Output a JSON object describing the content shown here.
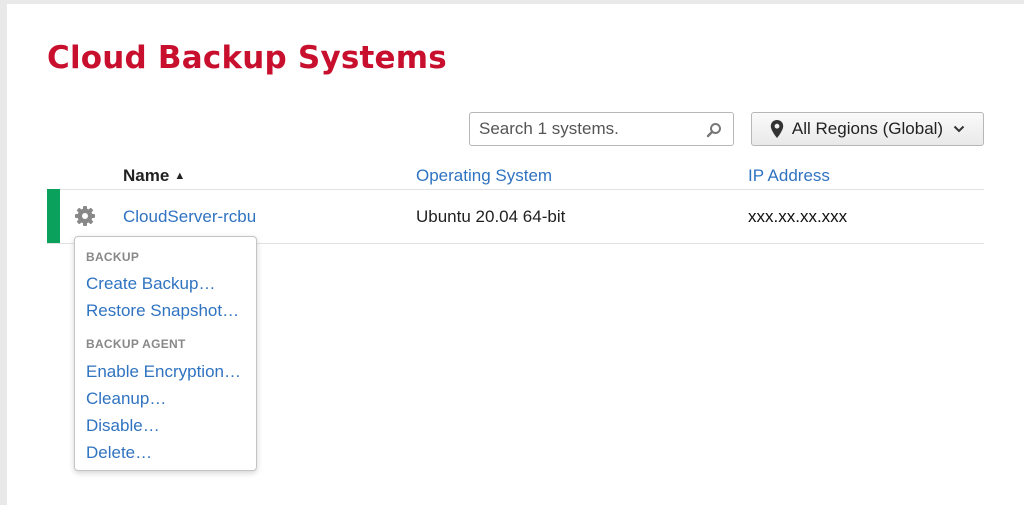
{
  "page": {
    "title": "Cloud Backup Systems"
  },
  "search": {
    "placeholder": "Search 1 systems."
  },
  "region": {
    "label": "All Regions (Global)"
  },
  "table": {
    "columns": {
      "name": "Name",
      "os": "Operating System",
      "ip": "IP Address"
    },
    "sort_indicator": "▲",
    "rows": [
      {
        "name": "CloudServer-rcbu",
        "os": "Ubuntu 20.04 64-bit",
        "ip": "xxx.xx.xx.xxx",
        "status_color": "#0aa15c"
      }
    ]
  },
  "menu": {
    "backup_header": "BACKUP",
    "create_backup": "Create Backup…",
    "restore_snapshot": "Restore Snapshot…",
    "agent_header": "BACKUP AGENT",
    "enable_encryption": "Enable Encryption…",
    "cleanup": "Cleanup…",
    "disable": "Disable…",
    "delete": "Delete…"
  },
  "colors": {
    "title": "#c8102e",
    "link": "#2f73c1",
    "status_ok": "#0aa15c"
  },
  "icons": {
    "search": "search-icon",
    "region": "map-pin-icon",
    "dropdown": "chevron-down-icon",
    "actions": "gear-icon"
  }
}
